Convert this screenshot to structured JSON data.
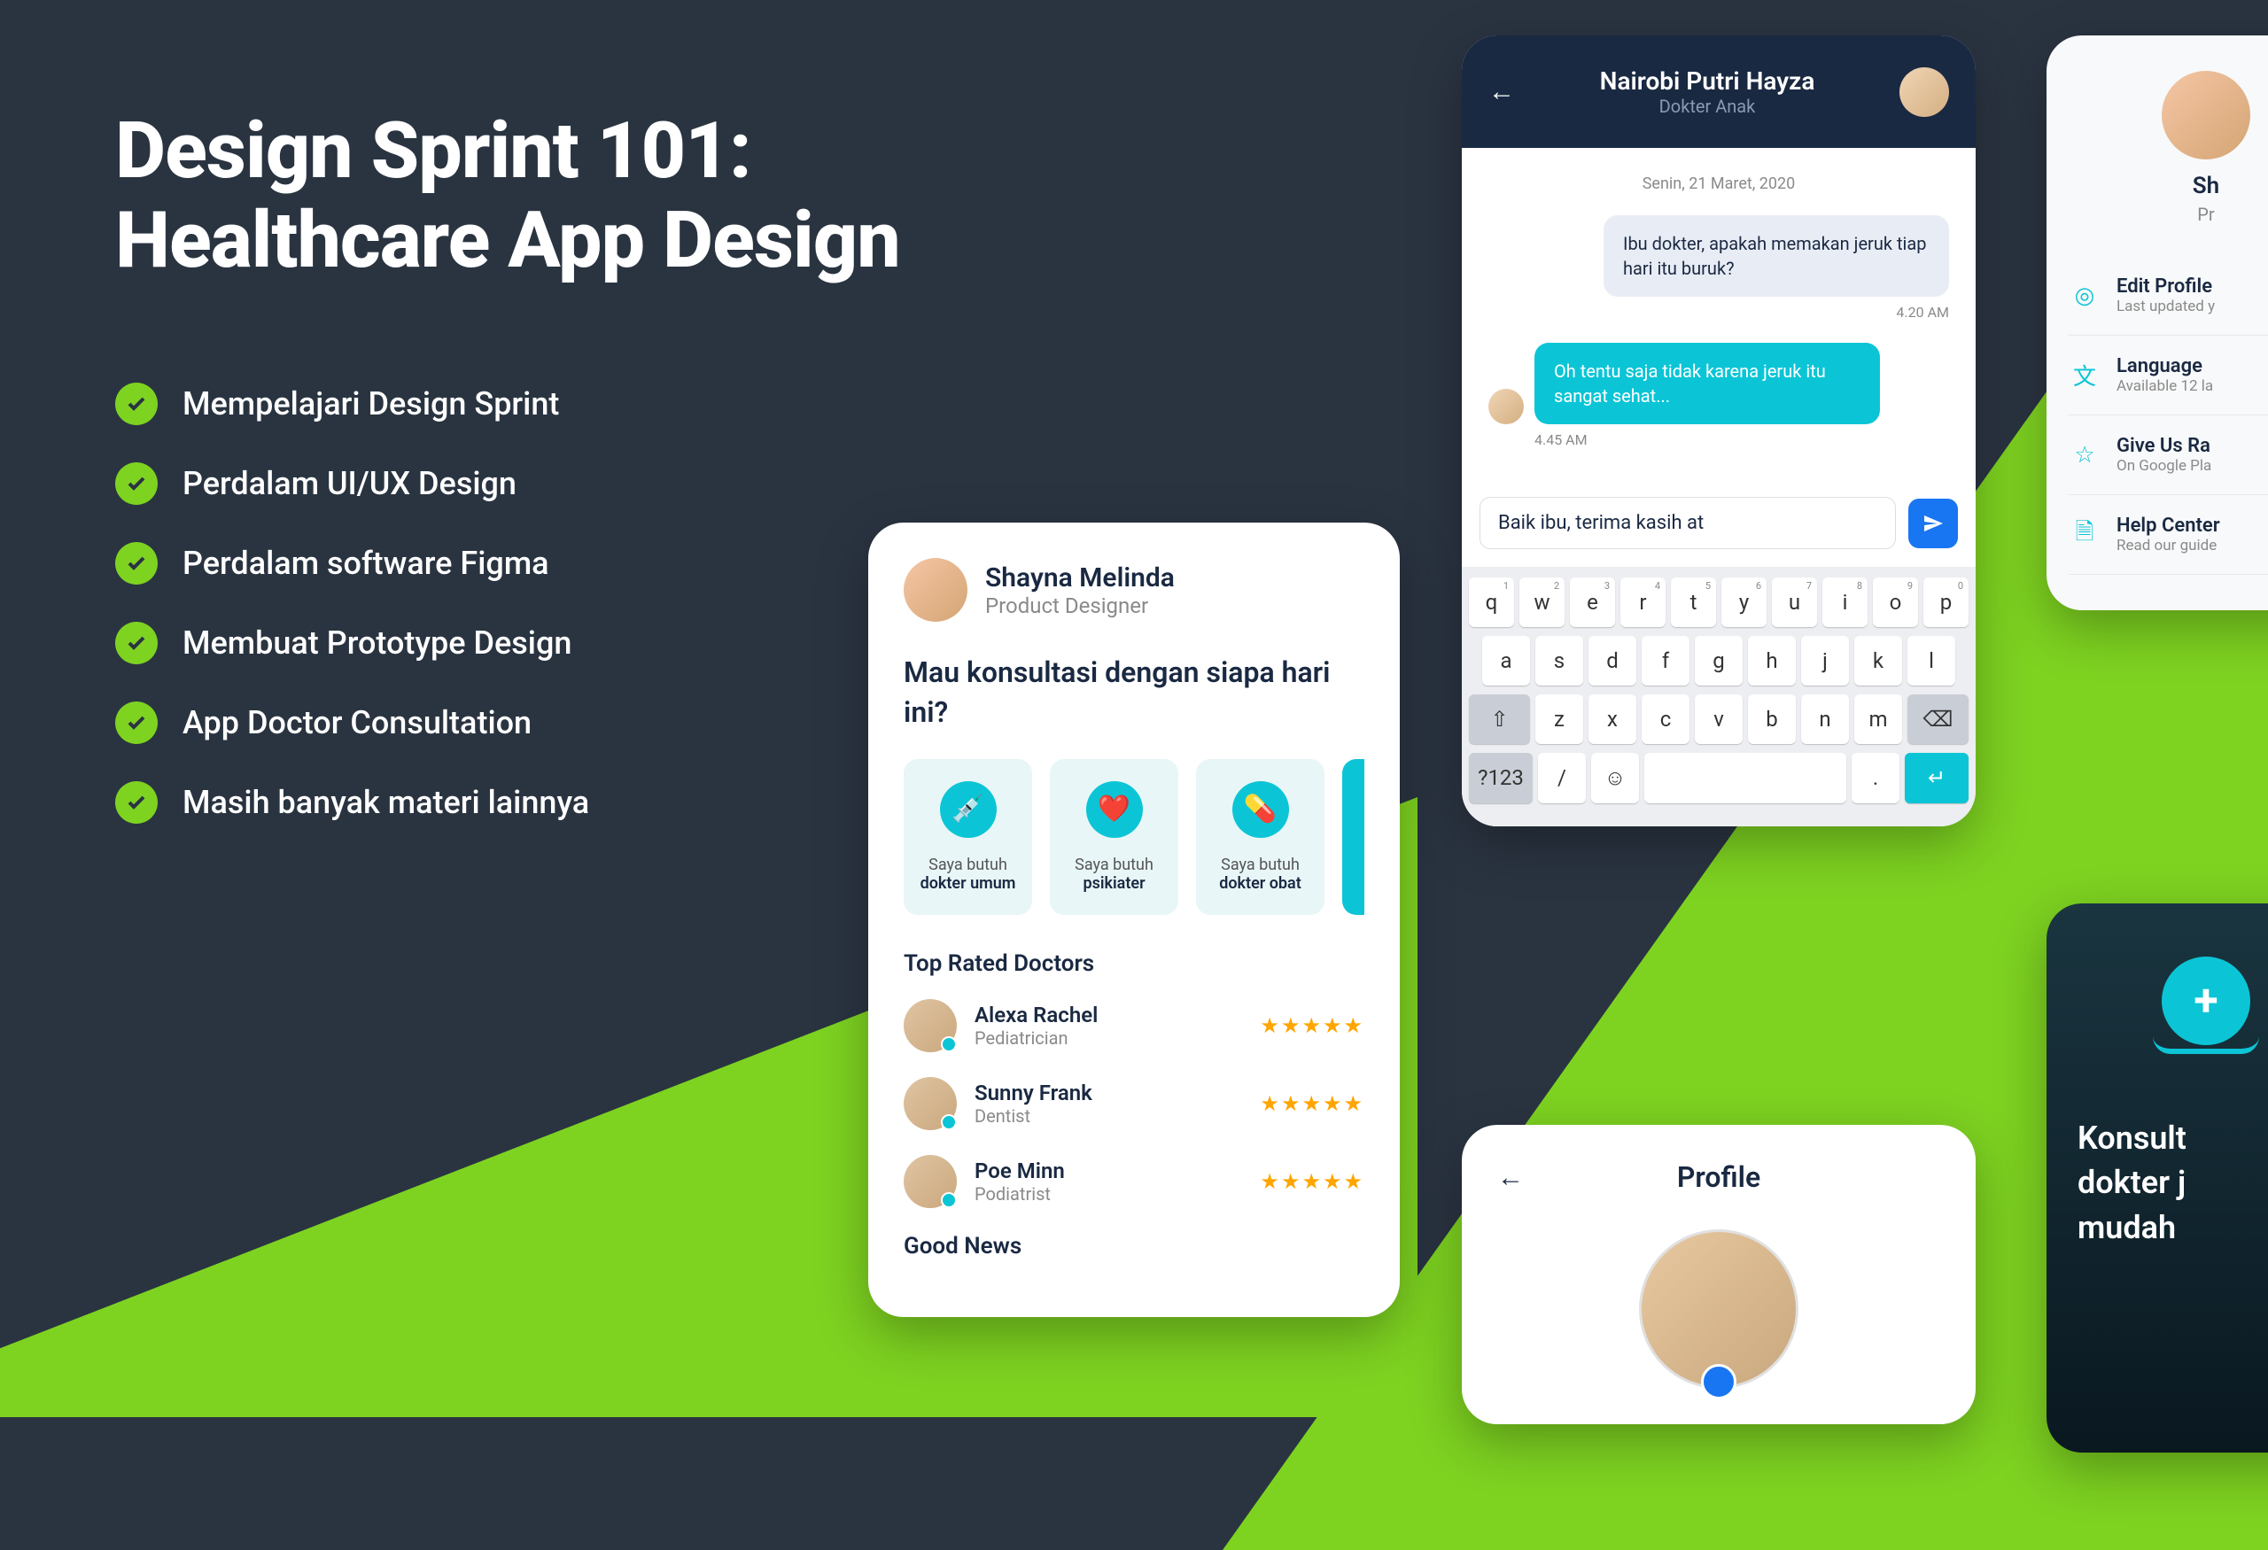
{
  "title_line1": "Design Sprint 101:",
  "title_line2": "Healthcare App Design",
  "bullets": [
    "Mempelajari Design Sprint",
    "Perdalam UI/UX Design",
    "Perdalam software Figma",
    "Membuat Prototype Design",
    "App Doctor Consultation",
    "Masih banyak materi lainnya"
  ],
  "home": {
    "user_name": "Shayna Melinda",
    "user_role": "Product Designer",
    "question": "Mau konsultasi dengan siapa hari ini?",
    "categories": [
      {
        "label": "Saya butuh",
        "bold": "dokter umum",
        "icon": "💉"
      },
      {
        "label": "Saya butuh",
        "bold": "psikiater",
        "icon": "❤️"
      },
      {
        "label": "Saya butuh",
        "bold": "dokter obat",
        "icon": "💊"
      }
    ],
    "section_doctors": "Top Rated Doctors",
    "doctors": [
      {
        "name": "Alexa Rachel",
        "spec": "Pediatrician"
      },
      {
        "name": "Sunny Frank",
        "spec": "Dentist"
      },
      {
        "name": "Poe Minn",
        "spec": "Podiatrist"
      }
    ],
    "section_news": "Good News"
  },
  "chat": {
    "name": "Nairobi Putri Hayza",
    "role": "Dokter Anak",
    "date": "Senin, 21 Maret, 2020",
    "msg1": "Ibu dokter, apakah memakan jeruk tiap hari itu buruk?",
    "time1": "4.20 AM",
    "msg2": "Oh tentu saja tidak karena jeruk itu sangat sehat...",
    "time2": "4.45 AM",
    "input": "Baik ibu, terima kasih at",
    "kb_row1": [
      "q",
      "w",
      "e",
      "r",
      "t",
      "y",
      "u",
      "i",
      "o",
      "p"
    ],
    "kb_nums": [
      "1",
      "2",
      "3",
      "4",
      "5",
      "6",
      "7",
      "8",
      "9",
      "0"
    ],
    "kb_row2": [
      "a",
      "s",
      "d",
      "f",
      "g",
      "h",
      "j",
      "k",
      "l"
    ],
    "kb_row3": [
      "z",
      "x",
      "c",
      "v",
      "b",
      "n",
      "m"
    ],
    "kb_sym": "?123"
  },
  "profile": {
    "title": "Profile"
  },
  "settings": {
    "name_partial": "Sh",
    "role_partial": "Pr",
    "items": [
      {
        "icon": "◎",
        "title": "Edit Profile",
        "sub": "Last updated y"
      },
      {
        "icon": "文",
        "title": "Language",
        "sub": "Available 12 la"
      },
      {
        "icon": "☆",
        "title": "Give Us Ra",
        "sub": "On Google Pla"
      },
      {
        "icon": "🗎",
        "title": "Help Center",
        "sub": "Read our guide"
      }
    ]
  },
  "splash": {
    "text": "Konsult\ndokter j\nmudah"
  }
}
